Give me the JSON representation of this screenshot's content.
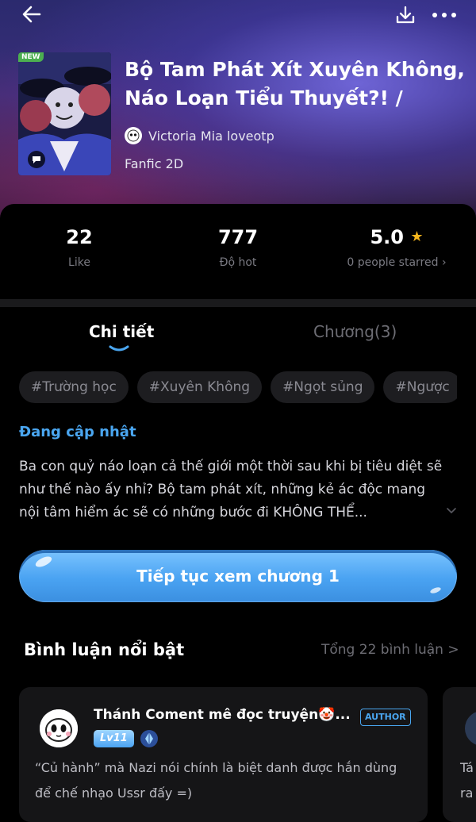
{
  "header": {
    "new_badge": "NEW",
    "title": "Bộ Tam Phát Xít Xuyên Không, Náo Loạn Tiểu Thuyết?! /",
    "author": "Victoria Mia loveotp",
    "category": "Fanfic 2D"
  },
  "stats": {
    "likes": "22",
    "likes_label": "Like",
    "hot": "777",
    "hot_label": "Độ hot",
    "rating": "5.0",
    "rating_label": "0 people starred ›"
  },
  "tabs": [
    {
      "label": "Chi tiết",
      "active": true
    },
    {
      "label": "Chương(3)",
      "active": false
    }
  ],
  "tags": [
    "#Trường học",
    "#Xuyên Không",
    "#Ngọt sủng",
    "#Ngược"
  ],
  "status": "Đang cập nhật",
  "description": "Ba con quỷ náo loạn cả thế giới một thời sau khi bị tiêu diệt sẽ như thế nào ấy nhỉ? Bộ tam phát xít, những kẻ ác độc mang nội tâm hiểm ác sẽ có những bước đi KHÔNG THỂ...",
  "cta_label": "Tiếp tục xem chương 1",
  "comments": {
    "title": "Bình luận nổi bật",
    "total": "Tổng 22 bình luận >",
    "items": [
      {
        "name": "Thánh Coment mê đọc truyện🤡...",
        "badge": "AUTHOR",
        "level": "Lv11",
        "text": "“Củ hành” mà Nazi nói chính là biệt danh được hắn dùng để chế nhạo Ussr đấy =)"
      },
      {
        "text_line1": "Tá",
        "text_line2": "ra"
      }
    ]
  },
  "colors": {
    "accent": "#4aa6f0",
    "star": "#f5b51c",
    "background": "#000000"
  }
}
